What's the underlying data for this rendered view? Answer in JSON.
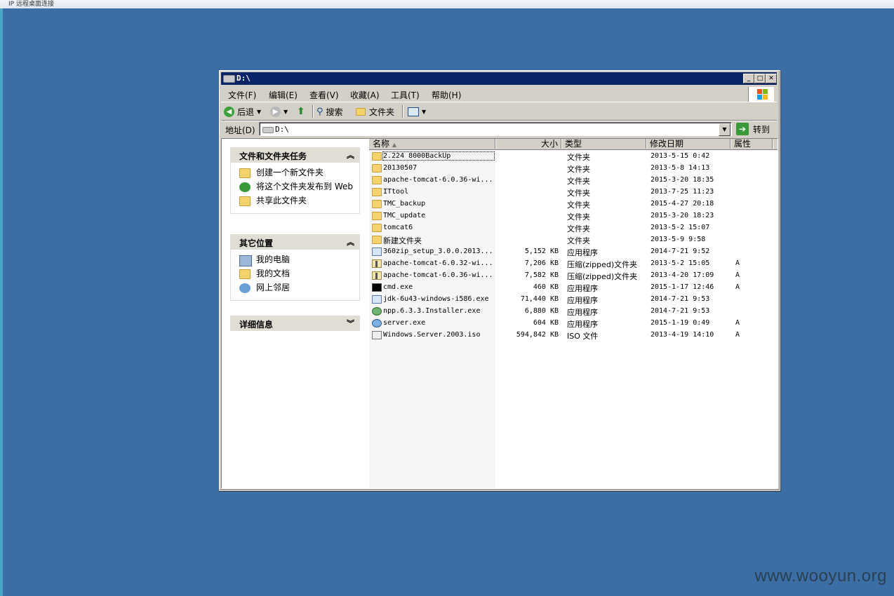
{
  "outer": {
    "title": "IP 远程桌面连接",
    "watermark": "www.wooyun.org"
  },
  "window": {
    "title": "D:\\",
    "menu": [
      "文件(F)",
      "编辑(E)",
      "查看(V)",
      "收藏(A)",
      "工具(T)",
      "帮助(H)"
    ],
    "toolbar": {
      "back": "后退",
      "search": "搜索",
      "folders": "文件夹"
    },
    "address": {
      "label": "地址(D)",
      "value": "D:\\",
      "go": "转到"
    }
  },
  "taskpane": {
    "file_tasks": {
      "title": "文件和文件夹任务",
      "items": [
        "创建一个新文件夹",
        "将这个文件夹发布到 Web",
        "共享此文件夹"
      ]
    },
    "other_places": {
      "title": "其它位置",
      "items": [
        "我的电脑",
        "我的文档",
        "网上邻居"
      ]
    },
    "details": {
      "title": "详细信息"
    }
  },
  "list": {
    "columns": {
      "name": "名称",
      "size": "大小",
      "type": "类型",
      "modified": "修改日期",
      "attr": "属性"
    },
    "files": [
      {
        "icon": "folder-icon",
        "name": "2.224 8000BackUp",
        "size": "",
        "type": "文件夹",
        "modified": "2013-5-15 0:42",
        "attr": ""
      },
      {
        "icon": "folder-icon",
        "name": "20130507",
        "size": "",
        "type": "文件夹",
        "modified": "2013-5-8 14:13",
        "attr": ""
      },
      {
        "icon": "folder-icon",
        "name": "apache-tomcat-6.0.36-wi...",
        "size": "",
        "type": "文件夹",
        "modified": "2015-3-20 18:35",
        "attr": ""
      },
      {
        "icon": "folder-icon",
        "name": "ITtool",
        "size": "",
        "type": "文件夹",
        "modified": "2013-7-25 11:23",
        "attr": ""
      },
      {
        "icon": "folder-icon",
        "name": "TMC_backup",
        "size": "",
        "type": "文件夹",
        "modified": "2015-4-27 20:18",
        "attr": ""
      },
      {
        "icon": "folder-icon",
        "name": "TMC_update",
        "size": "",
        "type": "文件夹",
        "modified": "2015-3-20 18:23",
        "attr": ""
      },
      {
        "icon": "folder-icon",
        "name": "tomcat6",
        "size": "",
        "type": "文件夹",
        "modified": "2013-5-2 15:07",
        "attr": ""
      },
      {
        "icon": "folder-icon",
        "name": "新建文件夹",
        "size": "",
        "type": "文件夹",
        "modified": "2013-5-9 9:58",
        "attr": ""
      },
      {
        "icon": "installer-icon",
        "name": "360zip_setup_3.0.0.2013...",
        "size": "5,152 KB",
        "type": "应用程序",
        "modified": "2014-7-21 9:52",
        "attr": ""
      },
      {
        "icon": "zip-icon",
        "name": "apache-tomcat-6.0.32-wi...",
        "size": "7,206 KB",
        "type": "压缩(zipped)文件夹",
        "modified": "2013-5-2 15:05",
        "attr": "A"
      },
      {
        "icon": "zip-icon",
        "name": "apache-tomcat-6.0.36-wi...",
        "size": "7,582 KB",
        "type": "压缩(zipped)文件夹",
        "modified": "2013-4-20 17:09",
        "attr": "A"
      },
      {
        "icon": "cmd-icon",
        "name": "cmd.exe",
        "size": "460 KB",
        "type": "应用程序",
        "modified": "2015-1-17 12:46",
        "attr": "A"
      },
      {
        "icon": "java-icon",
        "name": "jdk-6u43-windows-i586.exe",
        "size": "71,440 KB",
        "type": "应用程序",
        "modified": "2014-7-21 9:53",
        "attr": ""
      },
      {
        "icon": "gear-icon",
        "name": "npp.6.3.3.Installer.exe",
        "size": "6,880 KB",
        "type": "应用程序",
        "modified": "2014-7-21 9:53",
        "attr": ""
      },
      {
        "icon": "disk-icon",
        "name": "server.exe",
        "size": "604 KB",
        "type": "应用程序",
        "modified": "2015-1-19 0:49",
        "attr": "A"
      },
      {
        "icon": "iso-icon",
        "name": "Windows.Server.2003.iso",
        "size": "594,842 KB",
        "type": "ISO 文件",
        "modified": "2013-4-19 14:10",
        "attr": "A"
      }
    ]
  }
}
